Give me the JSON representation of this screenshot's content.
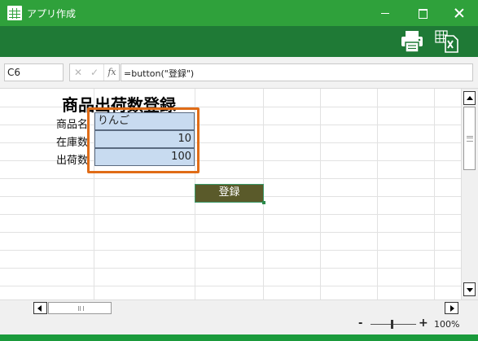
{
  "window": {
    "title": "アプリ作成"
  },
  "icons": {
    "app": "spreadsheet-icon",
    "print": "printer-icon",
    "excel": "excel-export-icon",
    "minimize": "minimize-icon",
    "maximize": "maximize-icon",
    "close": "close-icon"
  },
  "formula_bar": {
    "cell_ref": "C6",
    "cancel_glyph": "✕",
    "confirm_glyph": "✓",
    "fx_glyph": "fx",
    "formula": "=button(\"登録\")"
  },
  "sheet": {
    "title": "商品出荷数登録",
    "rows": [
      {
        "label": "商品名",
        "value": "りんご",
        "numeric": false
      },
      {
        "label": "在庫数",
        "value": "10",
        "numeric": true
      },
      {
        "label": "出荷数",
        "value": "100",
        "numeric": true
      }
    ],
    "button_label": "登録"
  },
  "statusbar": {
    "zoom_minus": "-",
    "zoom_plus": "+",
    "zoom": "100%"
  },
  "colors": {
    "titlebar": "#2fa13b",
    "ribbon": "#1f7a36",
    "input_fill": "#c8dbf0",
    "highlight": "#e06c17",
    "button": "#5a5a2a"
  }
}
